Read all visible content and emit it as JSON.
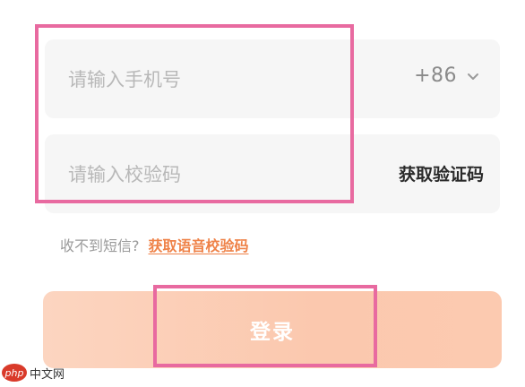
{
  "phone_field": {
    "placeholder": "请输入手机号",
    "country_code": "+86"
  },
  "code_field": {
    "placeholder": "请输入校验码",
    "get_code_label": "获取验证码"
  },
  "sms_help": {
    "prompt": "收不到短信?",
    "voice_code_link": "获取语音校验码"
  },
  "login_button": {
    "label": "登录"
  },
  "watermark": {
    "logo_text": "php",
    "site_text": "中文网"
  },
  "colors": {
    "annotation_border": "#e86aa0",
    "link": "#ef8248",
    "login_button_bg": "#fbc8ae",
    "field_bg": "#f6f6f6"
  }
}
